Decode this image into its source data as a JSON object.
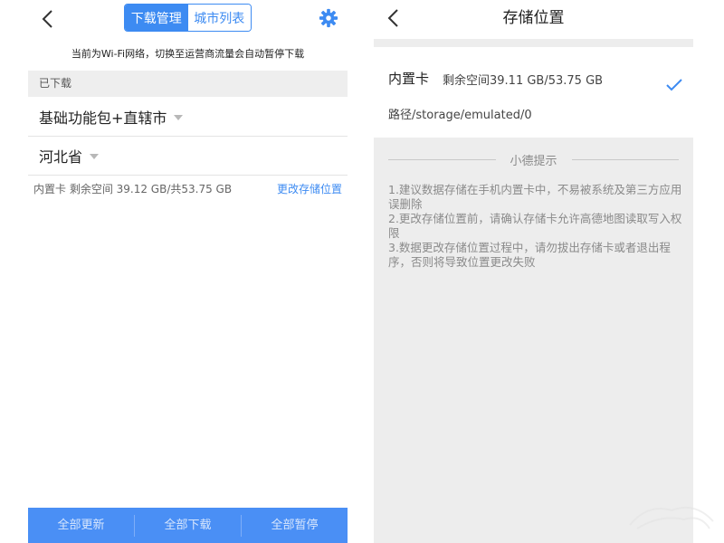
{
  "left": {
    "tabs": [
      {
        "label": "下载管理",
        "active": true
      },
      {
        "label": "城市列表",
        "active": false
      }
    ],
    "wifi_notice": "当前为Wi-Fi网络，切换至运营商流量会自动暂停下载",
    "section_title": "已下载",
    "rows": [
      {
        "label": "基础功能包+直辖市"
      },
      {
        "label": "河北省"
      }
    ],
    "storage_info": "内置卡 剩余空间 39.12 GB/共53.75 GB",
    "change_storage": "更改存储位置",
    "bottom_buttons": [
      "全部更新",
      "全部下载",
      "全部暂停"
    ],
    "colors": {
      "accent": "#3d8bf2",
      "bottom_bar": "#4a8ff5"
    }
  },
  "right": {
    "title": "存储位置",
    "storage": {
      "name": "内置卡",
      "space": "剩余空间39.11 GB/53.75 GB",
      "path": "路径/storage/emulated/0",
      "selected": true
    },
    "tips_title": "小德提示",
    "tips": [
      "1.建议数据存储在手机内置卡中，不易被系统及第三方应用误删除",
      "2.更改存储位置前，请确认存储卡允许高德地图读取写入权限",
      "3.数据更改存储位置过程中，请勿拔出存储卡或者退出程序，否则将导致位置更改失败"
    ]
  }
}
